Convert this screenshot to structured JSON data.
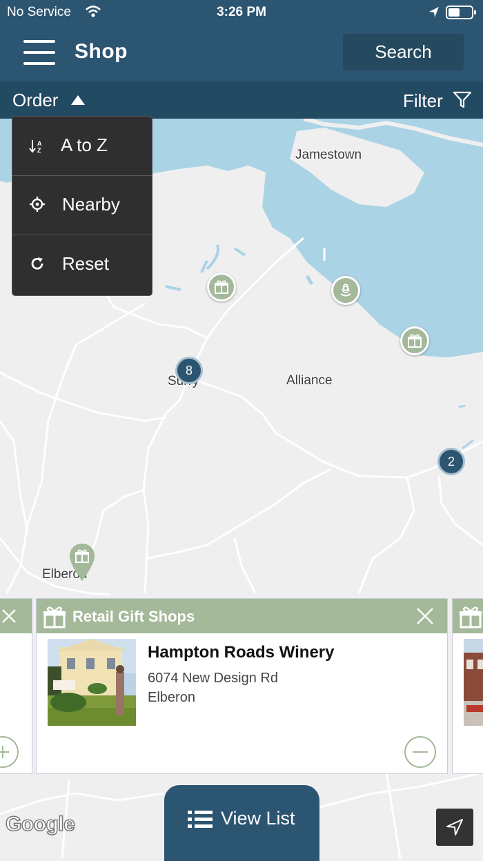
{
  "status_bar": {
    "carrier": "No Service",
    "time": "3:26 PM"
  },
  "header": {
    "title": "Shop",
    "search_label": "Search"
  },
  "subbar": {
    "order_label": "Order",
    "filter_label": "Filter"
  },
  "order_menu": {
    "items": [
      {
        "label": "A to Z",
        "icon": "sort-az-icon"
      },
      {
        "label": "Nearby",
        "icon": "crosshair-icon"
      },
      {
        "label": "Reset",
        "icon": "reset-icon"
      }
    ]
  },
  "map": {
    "labels": [
      "Jamestown",
      "Surry",
      "Alliance",
      "Elberon"
    ],
    "clusters": [
      "8",
      "2"
    ],
    "attribution": "Google"
  },
  "card": {
    "category": "Retail Gift Shops",
    "name": "Hampton Roads Winery",
    "address": "6074 New Design Rd",
    "city": "Elberon"
  },
  "bottom": {
    "view_list_label": "View List"
  },
  "colors": {
    "primary": "#2c5572",
    "accent": "#a4b89a",
    "water": "#aad3e6",
    "land": "#efefef"
  }
}
